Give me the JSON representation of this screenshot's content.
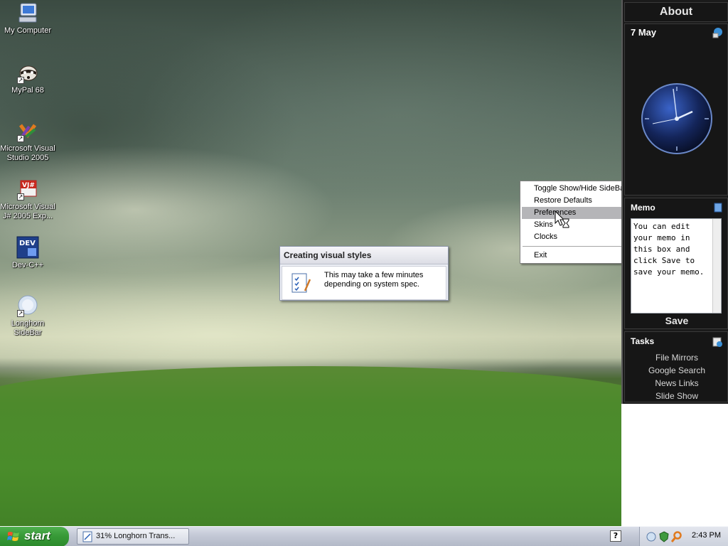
{
  "desktop": {
    "icons": [
      {
        "label": "My Computer",
        "icon": "computer-icon"
      },
      {
        "label": "MyPal 68",
        "icon": "raccoon-icon"
      },
      {
        "label": "Microsoft Visual Studio 2005",
        "icon": "visual-studio-icon"
      },
      {
        "label": "Microsoft Visual J# 2005 Exp...",
        "icon": "vj-sharp-icon"
      },
      {
        "label": "Dev-C++",
        "icon": "dev-cpp-icon"
      },
      {
        "label": "Longhorn SideBar",
        "icon": "longhorn-sidebar-icon"
      }
    ]
  },
  "dialog": {
    "title": "Creating visual styles",
    "message": "This may take a few minutes depending on system spec."
  },
  "context_menu": {
    "items": [
      {
        "label": "Toggle Show/Hide SideBar",
        "submenu": false
      },
      {
        "label": "Restore Defaults",
        "submenu": false
      },
      {
        "label": "Preferences",
        "submenu": false,
        "highlighted": true
      },
      {
        "label": "Skins",
        "submenu": true
      },
      {
        "label": "Clocks",
        "submenu": true
      },
      {
        "label": "Exit",
        "submenu": false
      }
    ]
  },
  "sidebar": {
    "about_label": "About",
    "date": "7 May",
    "memo": {
      "title": "Memo",
      "text": "You can edit your memo in this box and click Save to save your memo.",
      "save_label": "Save"
    },
    "tasks": {
      "title": "Tasks",
      "links": [
        "File Mirrors",
        "Google Search",
        "News Links",
        "Slide Show"
      ]
    }
  },
  "taskbar": {
    "start_label": "start",
    "task_button": "31% Longhorn Trans...",
    "clock": "2:43 PM",
    "tray_icons": [
      "network-icon",
      "security-icon",
      "search-icon"
    ]
  },
  "colors": {
    "sidebar_bg": "#161616",
    "menu_highlight": "#b5b5b8",
    "start_green": "#389a38"
  }
}
